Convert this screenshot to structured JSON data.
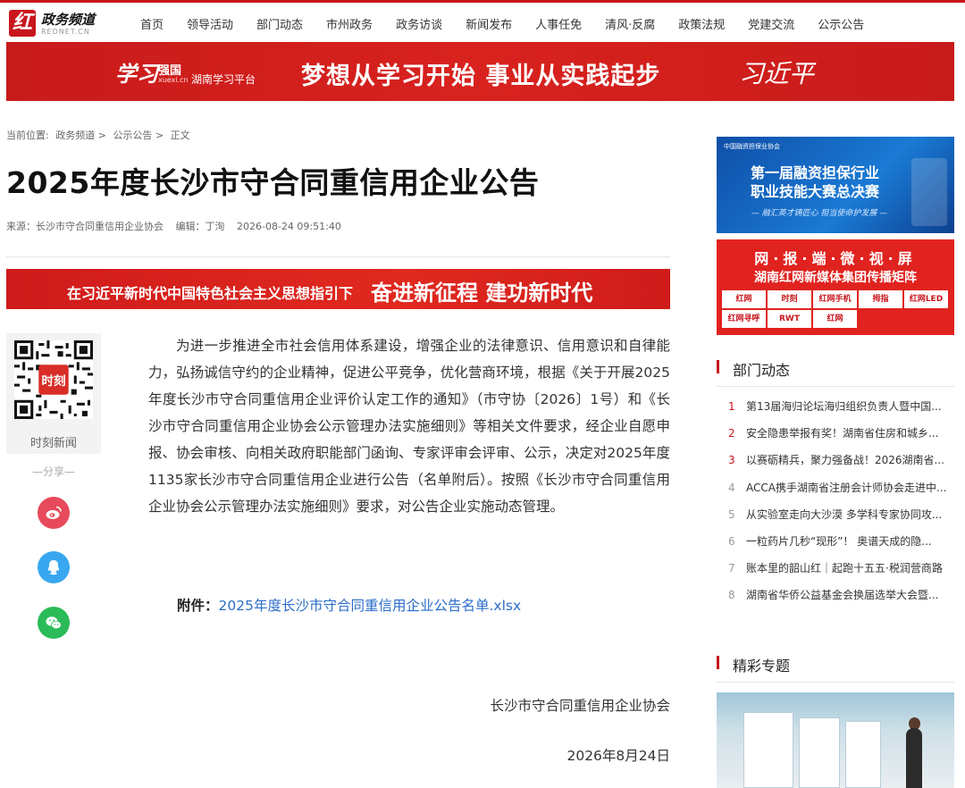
{
  "site": {
    "logo_char": "红",
    "title": "政务频道",
    "subtitle": "REDNET.CN"
  },
  "nav": [
    "首页",
    "领导活动",
    "部门动态",
    "市州政务",
    "政务访谈",
    "新闻发布",
    "人事任免",
    "清风·反腐",
    "政策法规",
    "党建交流",
    "公示公告"
  ],
  "banner": {
    "logo_script": "学习",
    "logo_text": "强国",
    "logo_url": "xuexi.cn",
    "platform": "湖南学习平台",
    "slogan": "梦想从学习开始  事业从实践起步",
    "signature": "习近平"
  },
  "breadcrumb": {
    "prefix": "当前位置:",
    "items": [
      "政务频道",
      "公示公告",
      "正文"
    ],
    "separator": ">"
  },
  "article": {
    "title": "2025年度长沙市守合同重信用企业公告",
    "source": "来源：长沙市守合同重信用企业协会",
    "editor": "编辑：丁洵",
    "time": "2026-08-24 09:51:40",
    "body": "为进一步推进全市社会信用体系建设，增强企业的法律意识、信用意识和自律能力，弘扬诚信守约的企业精神，促进公平竞争，优化营商环境，根据《关于开展2025年度长沙市守合同重信用企业评价认定工作的通知》（市守协〔2026〕1号）和《长沙市守合同重信用企业协会公示管理办法实施细则》等相关文件要求，经企业自愿申报、协会审核、向相关政府职能部门函询、专家评审会评审、公示，决定对2025年度1135家长沙市守合同重信用企业进行公告（名单附后）。按照《长沙市守合同重信用企业协会公示管理办法实施细则》要求，对公告企业实施动态管理。",
    "attachment_label": "附件：",
    "attachment_link": "2025年度长沙市守合同重信用企业公告名单.xlsx",
    "signature": "长沙市守合同重信用企业协会",
    "date": "2026年8月24日"
  },
  "slogan_banner": {
    "part_a": "在习近平新时代中国特色社会主义思想指引下",
    "part_b": "奋进新征程 建功新时代"
  },
  "share": {
    "qr_label": "时刻新闻",
    "qr_center": "时刻",
    "share_label": "—分享—",
    "icons": [
      "weibo-icon",
      "qq-icon",
      "wechat-icon"
    ]
  },
  "ads": {
    "ad1": {
      "org": "中国融资担保业协会",
      "headline_1": "第一届融资担保行业",
      "headline_2": "职业技能大赛总决赛",
      "tagline": "— 融汇英才铸匠心  担当使命护发展 —"
    },
    "ad2": {
      "title": "网·报·端·微·视·屏",
      "subtitle": "湖南红网新媒体集团传播矩阵",
      "brands": [
        "红网",
        "时刻",
        "红网手机",
        "拇指",
        "红网LED",
        "",
        "红网寻呼",
        "RWT",
        "红网",
        "",
        ""
      ]
    }
  },
  "sidebar": {
    "dept_title": "部门动态",
    "topic_title": "精彩专题",
    "news": [
      {
        "num": "1",
        "text": "第13届海归论坛海归组织负责人暨中国..."
      },
      {
        "num": "2",
        "text": "安全隐患举报有奖！湖南省住房和城乡..."
      },
      {
        "num": "3",
        "text": "以赛砺精兵，聚力强备战！2026湖南省..."
      },
      {
        "num": "4",
        "text": "ACCA携手湖南省注册会计师协会走进中..."
      },
      {
        "num": "5",
        "text": "从实验室走向大沙漠 多学科专家协同攻..."
      },
      {
        "num": "6",
        "text": "一粒药片几秒“现形”！ 奥谱天成的隐..."
      },
      {
        "num": "7",
        "text": "账本里的韶山红｜起跑十五五·税润营商路"
      },
      {
        "num": "8",
        "text": "湖南省华侨公益基金会换届选举大会暨..."
      }
    ]
  },
  "colors": {
    "brand_red": "#c8161d",
    "link_blue": "#2a6dc9",
    "weibo": "#e74a5a",
    "qq": "#38a7f0",
    "wechat": "#2bbb58"
  }
}
